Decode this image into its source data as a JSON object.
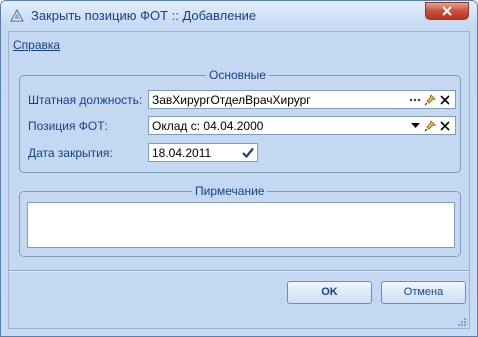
{
  "window": {
    "title": "Закрыть позицию ФОТ :: Добавление"
  },
  "menu": {
    "help": "Справка"
  },
  "main_group": {
    "title": "Основные",
    "fields": [
      {
        "label": "Штатная должность:",
        "value": "ЗавХирургОтделВрачХирург"
      },
      {
        "label": "Позиция ФОТ:",
        "value": "Оклад с: 04.04.2000"
      },
      {
        "label": "Дата закрытия:",
        "value": "18.04.2011"
      }
    ]
  },
  "note_group": {
    "title": "Пирмечание",
    "value": ""
  },
  "buttons": {
    "ok": "OK",
    "cancel": "Отмена"
  }
}
